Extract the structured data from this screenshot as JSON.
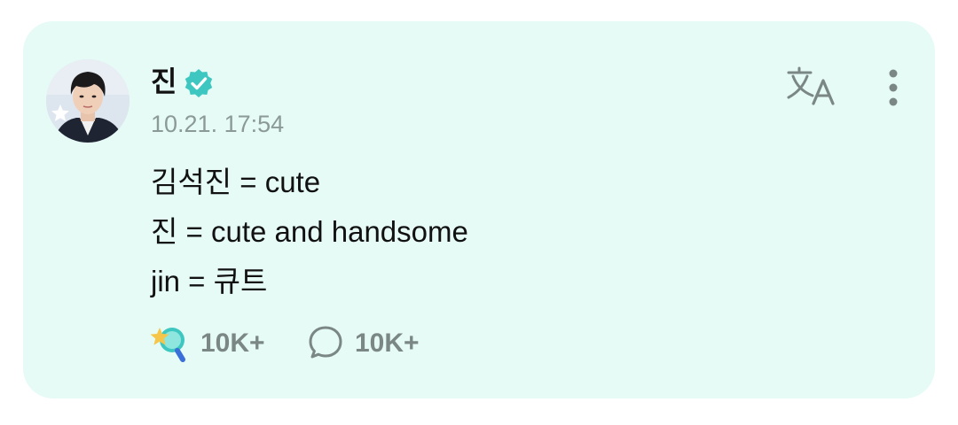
{
  "post": {
    "author": "진",
    "timestamp": "10.21. 17:54",
    "lines": [
      "김석진 = cute",
      "진 = cute and handsome",
      "jin = 큐트"
    ],
    "reactions": {
      "likes_count": "10K+",
      "comments_count": "10K+"
    }
  },
  "colors": {
    "card_background": "#e6fbf6",
    "verified_badge": "#3ec7c0",
    "icon_gray": "#7a8785",
    "timestamp_gray": "#8c9a97"
  },
  "icons": {
    "verified": "verified-check-icon",
    "translate": "translate-icon",
    "more": "more-vertical-icon",
    "like": "star-lightstick-icon",
    "comment": "comment-bubble-icon"
  }
}
